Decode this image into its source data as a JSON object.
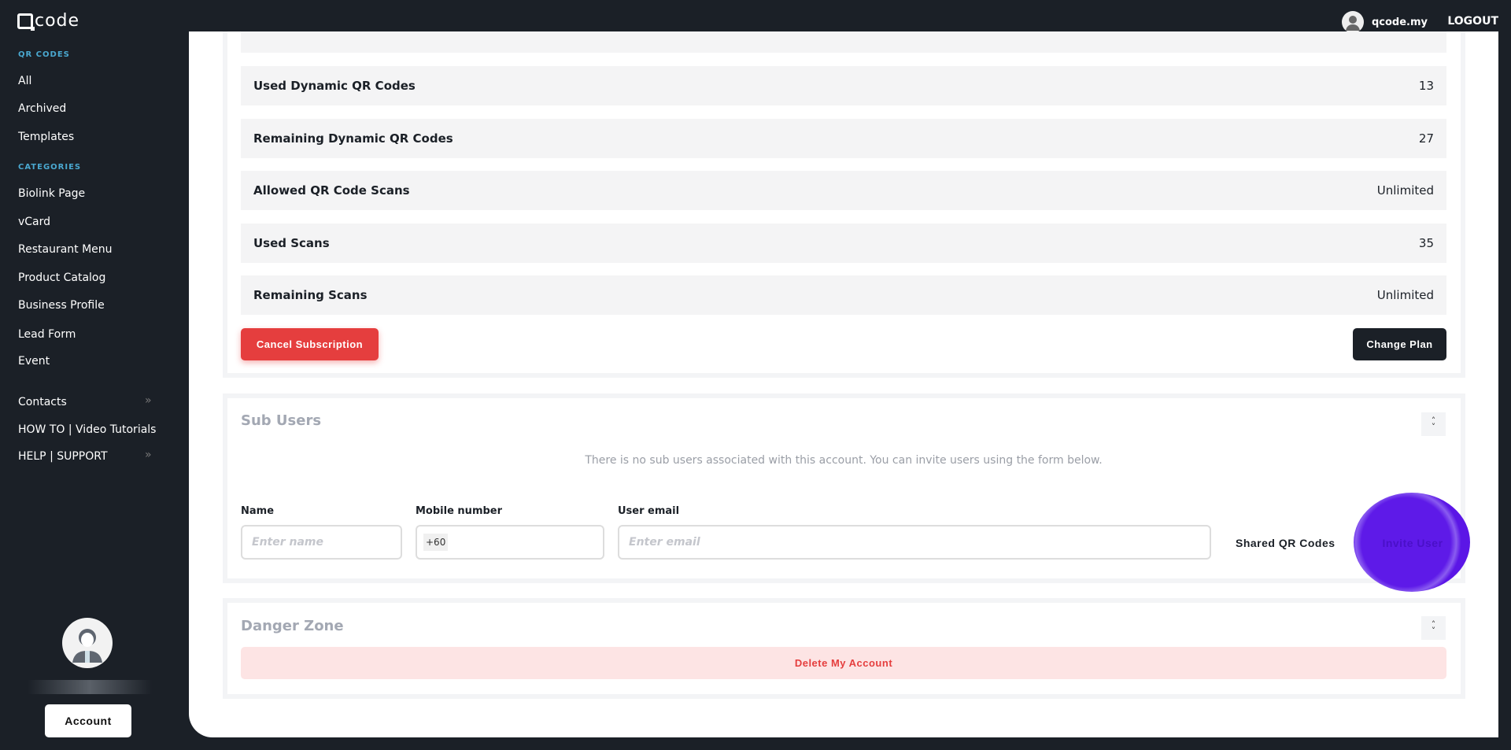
{
  "header": {
    "logo": "code",
    "username": "qcode.my",
    "logout": "LOGOUT"
  },
  "sidebar": {
    "section_qr": "QR CODES",
    "qr_items": [
      "All",
      "Archived",
      "Templates"
    ],
    "section_categories": "CATEGORIES",
    "category_items": [
      "Biolink Page",
      "vCard",
      "Restaurant Menu",
      "Product Catalog",
      "Business Profile",
      "Lead Form",
      "Event"
    ],
    "extra_items": [
      "Contacts",
      "HOW TO | Video Tutorials",
      "HELP | SUPPORT"
    ],
    "account_button": "Account"
  },
  "plan": {
    "rows": [
      {
        "label": "Used Dynamic QR Codes",
        "value": "13"
      },
      {
        "label": "Remaining Dynamic QR Codes",
        "value": "27"
      },
      {
        "label": "Allowed QR Code Scans",
        "value": "Unlimited"
      },
      {
        "label": "Used Scans",
        "value": "35"
      },
      {
        "label": "Remaining Scans",
        "value": "Unlimited"
      }
    ],
    "cancel_button": "Cancel Subscription",
    "change_button": "Change Plan"
  },
  "sub_users": {
    "title": "Sub Users",
    "empty_message": "There is no sub users associated with this account. You can invite users using the form below.",
    "name_label": "Name",
    "name_placeholder": "Enter name",
    "mobile_label": "Mobile number",
    "mobile_prefix": "+60",
    "email_label": "User email",
    "email_placeholder": "Enter email",
    "shared_label": "Shared QR Codes",
    "invite_button": "Invite User"
  },
  "danger": {
    "title": "Danger Zone",
    "delete_button": "Delete My Account"
  },
  "colors": {
    "accent_red": "#e53e3e",
    "dark": "#1b2027",
    "purple": "#5b16e6"
  }
}
